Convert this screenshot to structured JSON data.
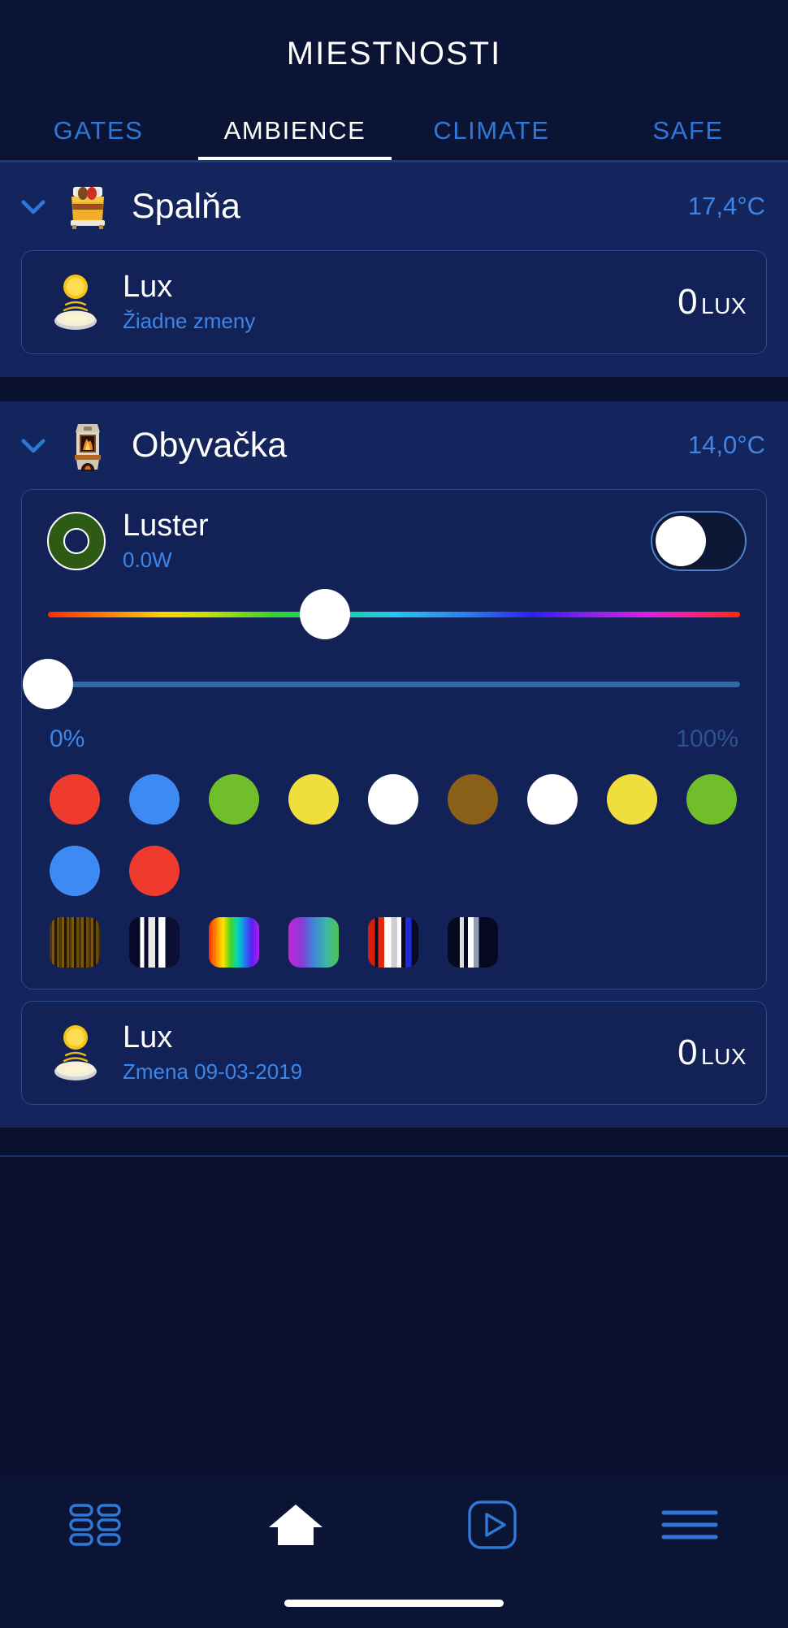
{
  "header": {
    "title": "MIESTNOSTI",
    "tabs": [
      {
        "label": "GATES",
        "active": false
      },
      {
        "label": "AMBIENCE",
        "active": true
      },
      {
        "label": "CLIMATE",
        "active": false
      },
      {
        "label": "SAFE",
        "active": false
      }
    ]
  },
  "rooms": [
    {
      "name": "Spalňa",
      "icon": "bed-icon",
      "temperature": "17,4°C",
      "expanded": true,
      "devices": [
        {
          "type": "sensor",
          "icon": "lux-sensor-icon",
          "name": "Lux",
          "sub": "Žiadne zmeny",
          "value": "0",
          "unit": "LUX"
        }
      ]
    },
    {
      "name": "Obyvačka",
      "icon": "fireplace-icon",
      "temperature": "14,0°C",
      "expanded": true,
      "devices": [
        {
          "type": "light",
          "icon": "light-donut-icon",
          "name": "Luster",
          "sub": "0.0W",
          "toggle_on": false,
          "hue_position_pct": 40,
          "brightness_position_pct": 0,
          "scale_min": "0%",
          "scale_max": "100%",
          "swatches": [
            "#ee3b2e",
            "#3d8bf2",
            "#6fbe2a",
            "#f0de3c",
            "#ffffff",
            "#8a6018",
            "#ffffff",
            "#f0de3c",
            "#6fbe2a",
            "#3d8bf2",
            "#ee3b2e"
          ],
          "effects": [
            "effect-warm-stripes",
            "effect-white-bars",
            "effect-rainbow",
            "effect-magenta-green",
            "effect-red-white-blue",
            "effect-cool-bars"
          ]
        },
        {
          "type": "sensor",
          "icon": "lux-sensor-icon",
          "name": "Lux",
          "sub": "Zmena 09-03-2019",
          "value": "0",
          "unit": "LUX"
        }
      ]
    }
  ],
  "bottom_nav": [
    {
      "icon": "dashboard-grid-icon",
      "active": false
    },
    {
      "icon": "home-icon",
      "active": true
    },
    {
      "icon": "play-box-icon",
      "active": false
    },
    {
      "icon": "menu-icon",
      "active": false
    }
  ],
  "colors": {
    "background": "#0a1130",
    "room_background": "#14245c",
    "card_background": "#132256",
    "accent_blue": "#3d86e8",
    "dim_blue": "#2c538f",
    "text_white": "#ffffff"
  }
}
